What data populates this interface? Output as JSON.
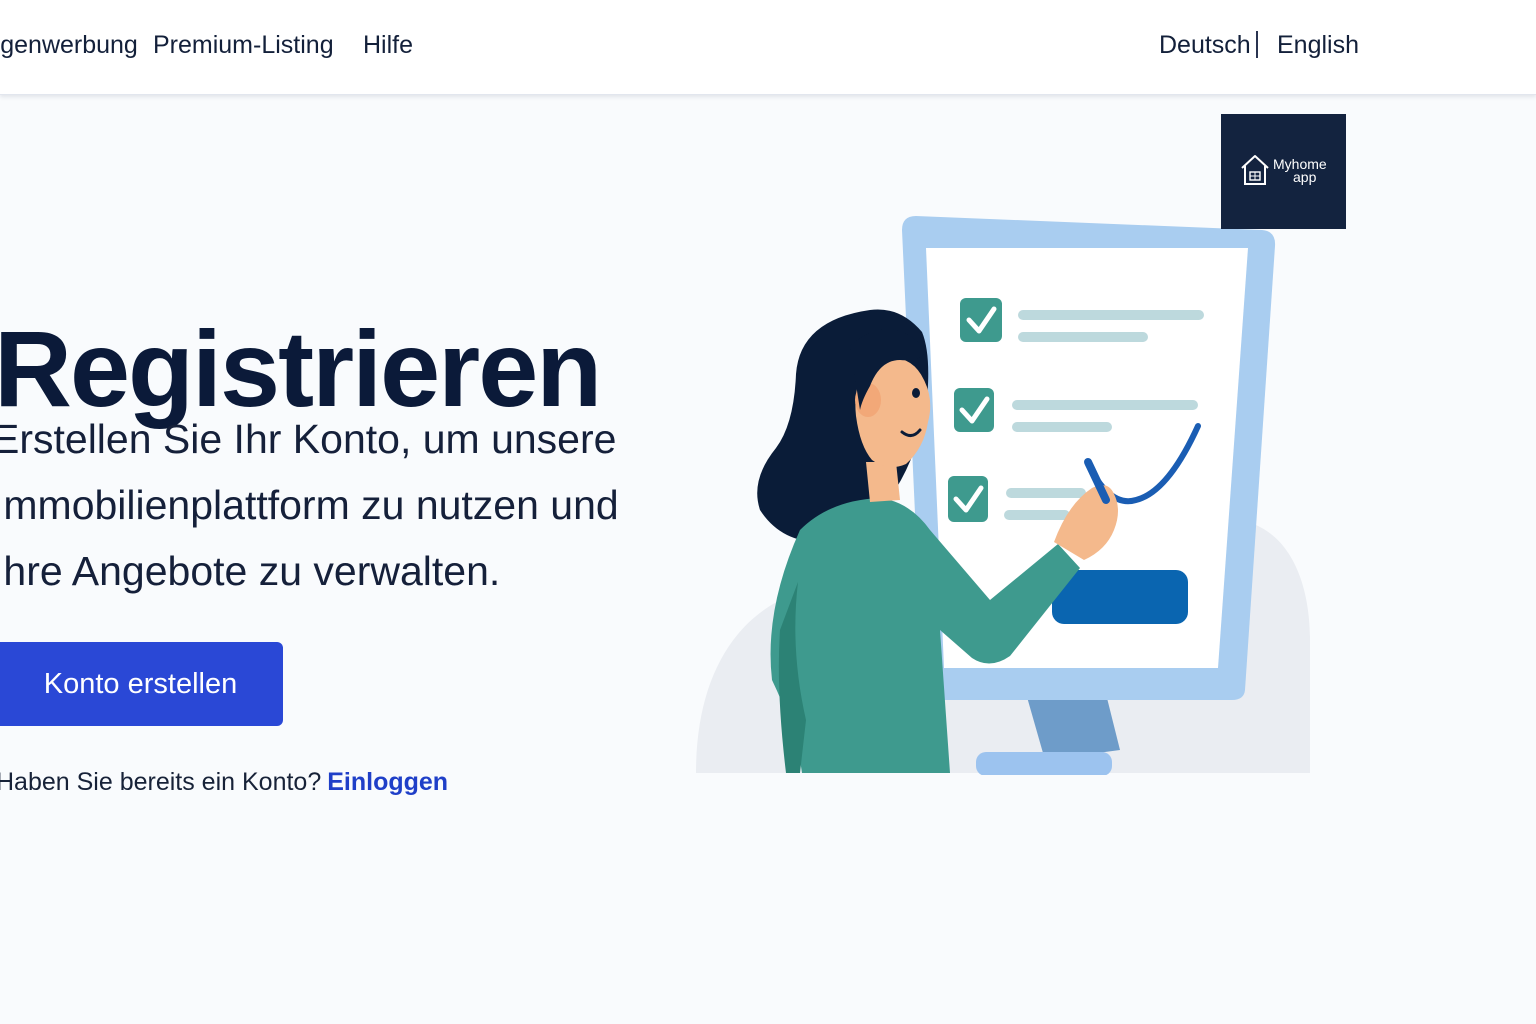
{
  "nav": {
    "links": [
      "Eigenwerbung",
      "Premium-Listing",
      "Hilfe"
    ],
    "languages": [
      "Deutsch",
      "English"
    ],
    "separator": "|"
  },
  "logo": {
    "line1": "Myhome",
    "line2": "app",
    "background": "#13233f"
  },
  "hero": {
    "title": "Registrieren",
    "description_lines": [
      "Erstellen Sie Ihr Konto, um unsere",
      "Immobilienplattform zu nutzen und",
      "Ihre Angebote zu verwalten."
    ],
    "cta_label": "Konto erstellen",
    "login_prompt": "Haben Sie bereits ein Konto?",
    "login_link": "Einloggen"
  },
  "colors": {
    "accent": "#2a48d6",
    "link": "#1f3fc8",
    "title": "#0b1a39",
    "teal": "#3e9a8e",
    "frame": "#a9cdf0"
  },
  "illustration": {
    "subject": "woman-checking-list-on-monitor-illustration"
  }
}
